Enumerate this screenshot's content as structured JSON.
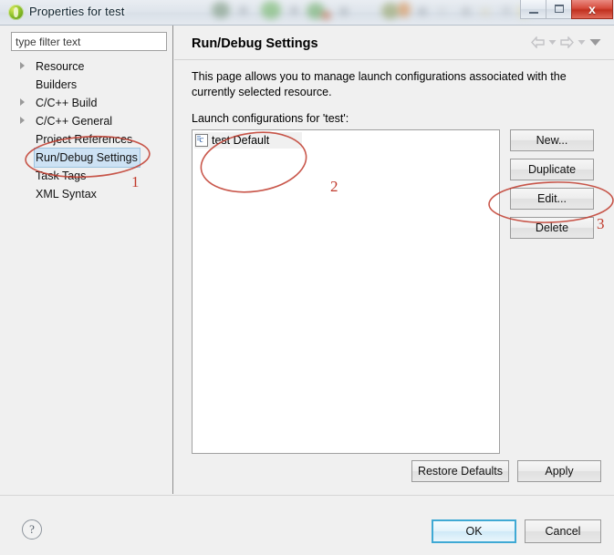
{
  "window": {
    "title": "Properties for test",
    "app_icon": "eclipse-icon",
    "controls": {
      "minimize": "minimize-icon",
      "maximize": "maximize-icon",
      "close": "x"
    }
  },
  "sidebar": {
    "filter": {
      "value": "type filter text",
      "placeholder": "type filter text"
    },
    "items": [
      {
        "label": "Resource",
        "expandable": true,
        "selected": false
      },
      {
        "label": "Builders",
        "expandable": false,
        "selected": false
      },
      {
        "label": "C/C++ Build",
        "expandable": true,
        "selected": false
      },
      {
        "label": "C/C++ General",
        "expandable": true,
        "selected": false
      },
      {
        "label": "Project References",
        "expandable": false,
        "selected": false
      },
      {
        "label": "Run/Debug Settings",
        "expandable": false,
        "selected": true
      },
      {
        "label": "Task Tags",
        "expandable": false,
        "selected": false
      },
      {
        "label": "XML Syntax",
        "expandable": false,
        "selected": false
      }
    ]
  },
  "page": {
    "title": "Run/Debug Settings",
    "description": "This page allows you to manage launch configurations associated with the currently selected resource.",
    "list_label": "Launch configurations for 'test':",
    "nav_icons": [
      "back-arrow-icon",
      "back-dropdown-icon",
      "forward-arrow-icon",
      "forward-dropdown-icon",
      "menu-caret-icon"
    ]
  },
  "launch_configurations": [
    {
      "name": "test Default",
      "icon": "c-file-icon"
    }
  ],
  "side_buttons": [
    {
      "label": "New..."
    },
    {
      "label": "Duplicate"
    },
    {
      "label": "Edit..."
    },
    {
      "label": "Delete"
    }
  ],
  "page_buttons": {
    "restore_defaults": "Restore Defaults",
    "apply": "Apply"
  },
  "footer": {
    "help": "?",
    "ok": "OK",
    "cancel": "Cancel"
  },
  "annotations": {
    "color": "#c0392b",
    "markers": [
      {
        "number": "1",
        "target": "Run/Debug Settings"
      },
      {
        "number": "2",
        "target": "test Default"
      },
      {
        "number": "3",
        "target": "Edit..."
      }
    ]
  }
}
